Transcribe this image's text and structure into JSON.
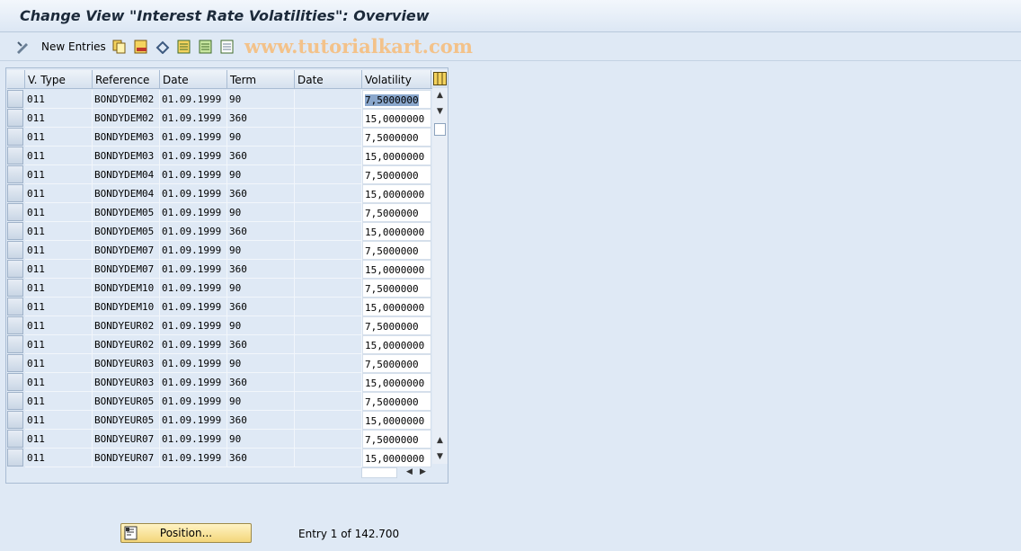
{
  "window": {
    "title": "Change View \"Interest Rate Volatilities\": Overview"
  },
  "toolbar": {
    "new_entries_label": "New Entries",
    "watermark": "www.tutorialkart.com",
    "icons": [
      "change-display-icon",
      "copy-icon",
      "delete-icon",
      "undo-icon",
      "select-all-icon",
      "select-block-icon",
      "deselect-all-icon"
    ]
  },
  "table": {
    "columns": [
      "V. Type",
      "Reference",
      "Date",
      "Term",
      "Date",
      "Volatility"
    ],
    "rows": [
      [
        "011",
        "BONDYDEM02",
        "01.09.1999",
        "90",
        "",
        "7,5000000"
      ],
      [
        "011",
        "BONDYDEM02",
        "01.09.1999",
        "360",
        "",
        "15,0000000"
      ],
      [
        "011",
        "BONDYDEM03",
        "01.09.1999",
        "90",
        "",
        "7,5000000"
      ],
      [
        "011",
        "BONDYDEM03",
        "01.09.1999",
        "360",
        "",
        "15,0000000"
      ],
      [
        "011",
        "BONDYDEM04",
        "01.09.1999",
        "90",
        "",
        "7,5000000"
      ],
      [
        "011",
        "BONDYDEM04",
        "01.09.1999",
        "360",
        "",
        "15,0000000"
      ],
      [
        "011",
        "BONDYDEM05",
        "01.09.1999",
        "90",
        "",
        "7,5000000"
      ],
      [
        "011",
        "BONDYDEM05",
        "01.09.1999",
        "360",
        "",
        "15,0000000"
      ],
      [
        "011",
        "BONDYDEM07",
        "01.09.1999",
        "90",
        "",
        "7,5000000"
      ],
      [
        "011",
        "BONDYDEM07",
        "01.09.1999",
        "360",
        "",
        "15,0000000"
      ],
      [
        "011",
        "BONDYDEM10",
        "01.09.1999",
        "90",
        "",
        "7,5000000"
      ],
      [
        "011",
        "BONDYDEM10",
        "01.09.1999",
        "360",
        "",
        "15,0000000"
      ],
      [
        "011",
        "BONDYEUR02",
        "01.09.1999",
        "90",
        "",
        "7,5000000"
      ],
      [
        "011",
        "BONDYEUR02",
        "01.09.1999",
        "360",
        "",
        "15,0000000"
      ],
      [
        "011",
        "BONDYEUR03",
        "01.09.1999",
        "90",
        "",
        "7,5000000"
      ],
      [
        "011",
        "BONDYEUR03",
        "01.09.1999",
        "360",
        "",
        "15,0000000"
      ],
      [
        "011",
        "BONDYEUR05",
        "01.09.1999",
        "90",
        "",
        "7,5000000"
      ],
      [
        "011",
        "BONDYEUR05",
        "01.09.1999",
        "360",
        "",
        "15,0000000"
      ],
      [
        "011",
        "BONDYEUR07",
        "01.09.1999",
        "90",
        "",
        "7,5000000"
      ],
      [
        "011",
        "BONDYEUR07",
        "01.09.1999",
        "360",
        "",
        "15,0000000"
      ]
    ],
    "active_cell": "row 1, Volatility"
  },
  "footer": {
    "position_button": "Position...",
    "entry_text": "Entry 1 of 142.700"
  },
  "colors": {
    "background": "#dfe9f5",
    "button": "#f3d67a",
    "watermark": "#f3c28a"
  }
}
